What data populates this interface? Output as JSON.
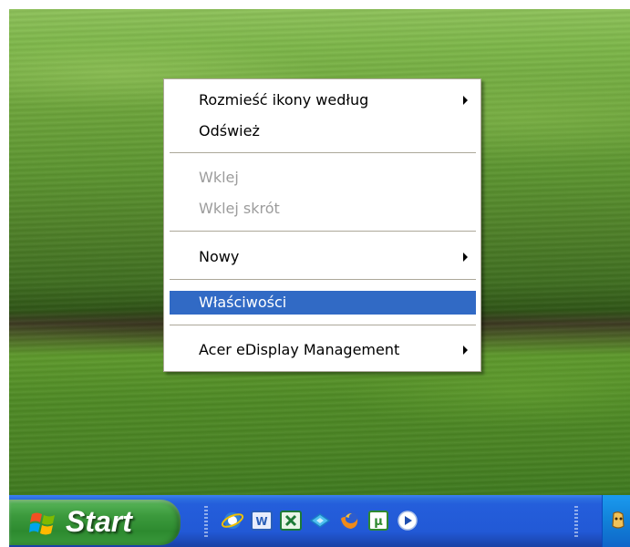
{
  "menu": {
    "items": [
      {
        "label": "Rozmieść ikony według",
        "submenu": true,
        "enabled": true
      },
      {
        "label": "Odśwież",
        "submenu": false,
        "enabled": true
      },
      {
        "label": "Wklej",
        "submenu": false,
        "enabled": false
      },
      {
        "label": "Wklej skrót",
        "submenu": false,
        "enabled": false
      },
      {
        "label": "Nowy",
        "submenu": true,
        "enabled": true
      },
      {
        "label": "Właściwości",
        "submenu": false,
        "enabled": true,
        "highlighted": true
      },
      {
        "label": "Acer eDisplay Management",
        "submenu": true,
        "enabled": true
      }
    ]
  },
  "taskbar": {
    "start_label": "Start",
    "quick_launch": [
      "internet-explorer-icon",
      "word-icon",
      "excel-icon",
      "network-icon",
      "firefox-icon",
      "utorrent-icon",
      "media-player-icon"
    ]
  },
  "colors": {
    "highlight": "#316ac5",
    "taskbar": "#245edb",
    "start_button": "#3c9a3d"
  }
}
